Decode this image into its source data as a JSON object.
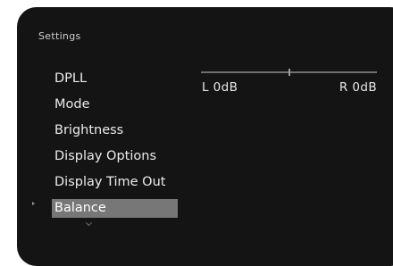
{
  "menu": {
    "title": "Settings",
    "items": [
      {
        "label": "DPLL"
      },
      {
        "label": "Mode"
      },
      {
        "label": "Brightness"
      },
      {
        "label": "Display Options"
      },
      {
        "label": "Display Time Out"
      },
      {
        "label": "Balance"
      }
    ],
    "selected_index": 5
  },
  "balance": {
    "left_label": "L 0dB",
    "right_label": "R 0dB",
    "position_fraction": 0.5
  },
  "colors": {
    "screen_bg": "#141414",
    "highlight": "#777777",
    "text": "#ebebeb"
  },
  "icons": {
    "selection_marker": "caret-right-icon",
    "scroll_indicator": "chevron-down-icon"
  }
}
